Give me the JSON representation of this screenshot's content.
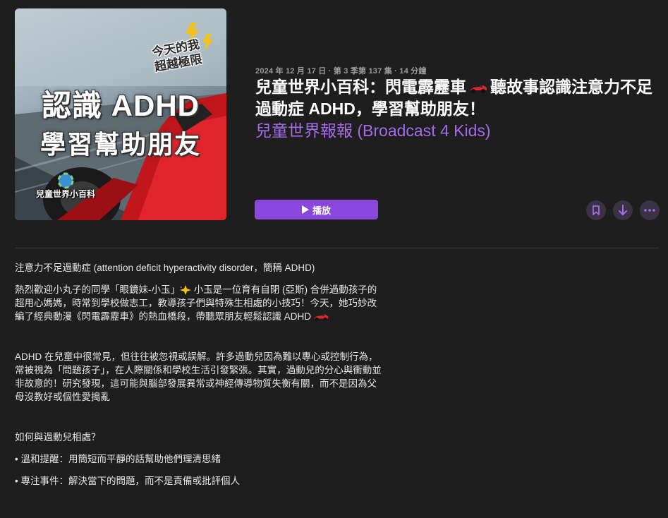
{
  "artwork": {
    "subtitle_line1": "今天的我",
    "subtitle_line2": "超越極限",
    "title_line1": "認識 ADHD",
    "title_line2": "學習幫助朋友",
    "brand": "兒童世界小百科"
  },
  "episode": {
    "meta": "2024 年 12 月 17 日 · 第 3 季第 137 集 · 14 分鐘",
    "title_part1": "兒童世界小百科：閃電霹靂車",
    "title_part2": "聽故事認識注意力不足過動症 ADHD，學習幫助朋友！",
    "show": "兒童世界報報 (Broadcast 4 Kids)"
  },
  "actions": {
    "play_label": "播放"
  },
  "description": {
    "p1": "注意力不足過動症 (attention deficit hyperactivity disorder，簡稱 ADHD)",
    "p2a": "熱烈歡迎小丸子的同學「眼鏡妹-小玉」",
    "p2b": " 小玉是一位育有自閉 (亞斯) 合併過動孩子的超用心媽媽，時常到學校做志工，教導孩子們與特殊生相處的小技巧！今天，她巧妙改編了經典動漫《閃電霹靂車》的熱血橋段，帶聽眾朋友輕鬆認識 ADHD",
    "p3": "ADHD 在兒童中很常見，但往往被忽視或誤解。許多過動兒因為難以專心或控制行為，常被視為「問題孩子」，在人際關係和學校生活引發緊張。其實，過動兒的分心與衝動並非故意的！研究發現，這可能與腦部發展異常或神經傳導物質失衡有關，而不是因為父母沒教好或個性愛搗亂",
    "p4": "如何與過動兒相處？",
    "p5": "• 溫和提醒：用簡短而平靜的話幫助他們理清思緒",
    "p6": "• 專注事件：解決當下的問題，而不是責備或批評個人"
  },
  "colors": {
    "accent": "#8a47dd",
    "link": "#a46ce8",
    "background": "#1e1e1e"
  },
  "icons": [
    "play-icon",
    "bookmark-icon",
    "download-icon",
    "more-icon",
    "race-car-icon",
    "sparkle-icon",
    "lightning-icon"
  ]
}
